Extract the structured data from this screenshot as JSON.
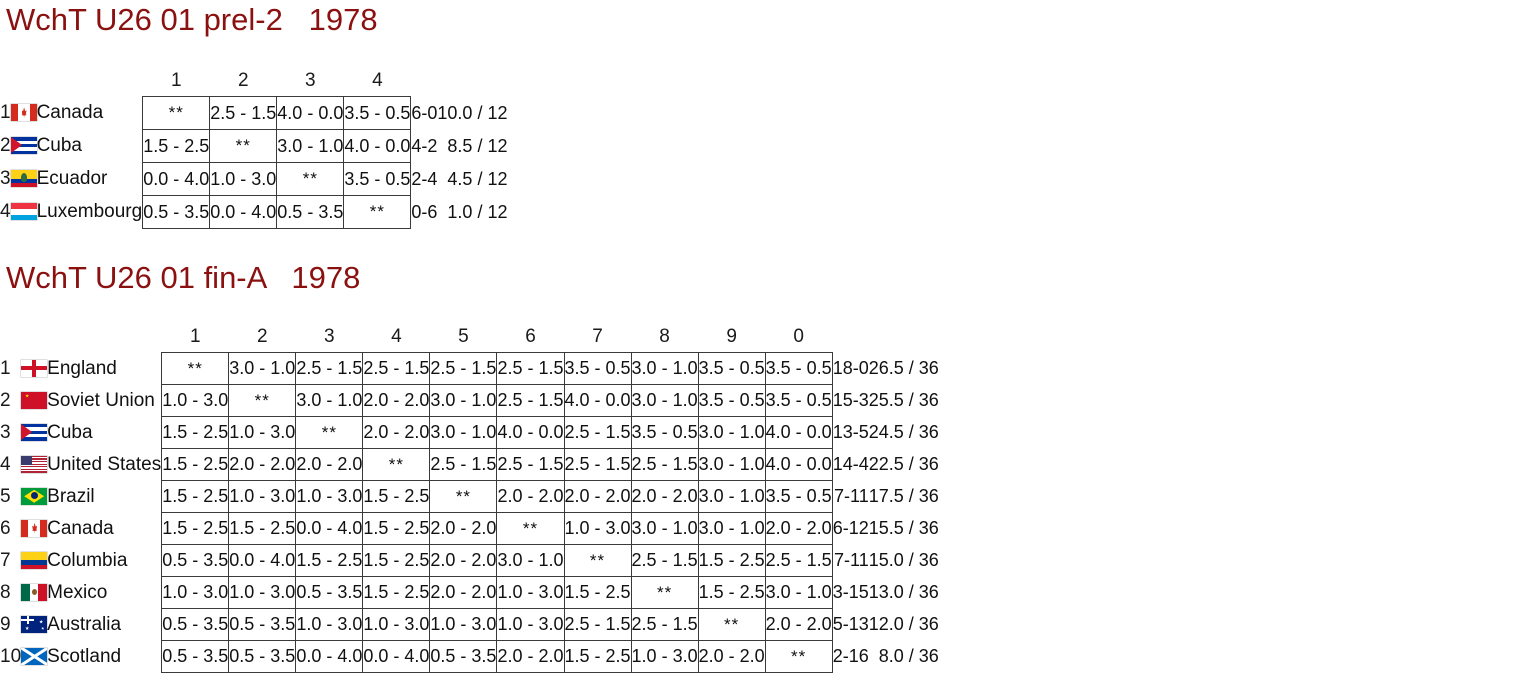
{
  "theme": {
    "title_color": "#8B1010",
    "text_color": "#111111",
    "border_color": "#3a3a3a"
  },
  "sections": [
    {
      "title": "WchT U26 01 prel-2   1978",
      "column_headers": [
        "1",
        "2",
        "3",
        "4"
      ],
      "rows": [
        {
          "rank": "1",
          "flag": "flag-canada",
          "team": "Canada",
          "cells": [
            "**",
            "2.5 - 1.5",
            "4.0 - 0.0",
            "3.5 - 0.5"
          ],
          "match_score": "6-0",
          "points": "10.0 / 12"
        },
        {
          "rank": "2",
          "flag": "flag-cuba",
          "team": "Cuba",
          "cells": [
            "1.5 - 2.5",
            "**",
            "3.0 - 1.0",
            "4.0 - 0.0"
          ],
          "match_score": "4-2",
          "points": "8.5 / 12"
        },
        {
          "rank": "3",
          "flag": "flag-ecuador",
          "team": "Ecuador",
          "cells": [
            "0.0 - 4.0",
            "1.0 - 3.0",
            "**",
            "3.5 - 0.5"
          ],
          "match_score": "2-4",
          "points": "4.5 / 12"
        },
        {
          "rank": "4",
          "flag": "flag-luxembourg",
          "team": "Luxembourg",
          "cells": [
            "0.5 - 3.5",
            "0.0 - 4.0",
            "0.5 - 3.5",
            "**"
          ],
          "match_score": "0-6",
          "points": "1.0 / 12"
        }
      ]
    },
    {
      "title": "WchT U26 01 fin-A   1978",
      "column_headers": [
        "1",
        "2",
        "3",
        "4",
        "5",
        "6",
        "7",
        "8",
        "9",
        "0"
      ],
      "rows": [
        {
          "rank": "1",
          "flag": "flag-england",
          "team": "England",
          "cells": [
            "**",
            "3.0 - 1.0",
            "2.5 - 1.5",
            "2.5 - 1.5",
            "2.5 - 1.5",
            "2.5 - 1.5",
            "3.5 - 0.5",
            "3.0 - 1.0",
            "3.5 - 0.5",
            "3.5 - 0.5"
          ],
          "match_score": "18-0",
          "points": "26.5 / 36"
        },
        {
          "rank": "2",
          "flag": "flag-soviet-union",
          "team": "Soviet Union",
          "cells": [
            "1.0 - 3.0",
            "**",
            "3.0 - 1.0",
            "2.0 - 2.0",
            "3.0 - 1.0",
            "2.5 - 1.5",
            "4.0 - 0.0",
            "3.0 - 1.0",
            "3.5 - 0.5",
            "3.5 - 0.5"
          ],
          "match_score": "15-3",
          "points": "25.5 / 36"
        },
        {
          "rank": "3",
          "flag": "flag-cuba",
          "team": "Cuba",
          "cells": [
            "1.5 - 2.5",
            "1.0 - 3.0",
            "**",
            "2.0 - 2.0",
            "3.0 - 1.0",
            "4.0 - 0.0",
            "2.5 - 1.5",
            "3.5 - 0.5",
            "3.0 - 1.0",
            "4.0 - 0.0"
          ],
          "match_score": "13-5",
          "points": "24.5 / 36"
        },
        {
          "rank": "4",
          "flag": "flag-united-states",
          "team": "United States",
          "cells": [
            "1.5 - 2.5",
            "2.0 - 2.0",
            "2.0 - 2.0",
            "**",
            "2.5 - 1.5",
            "2.5 - 1.5",
            "2.5 - 1.5",
            "2.5 - 1.5",
            "3.0 - 1.0",
            "4.0 - 0.0"
          ],
          "match_score": "14-4",
          "points": "22.5 / 36"
        },
        {
          "rank": "5",
          "flag": "flag-brazil",
          "team": "Brazil",
          "cells": [
            "1.5 - 2.5",
            "1.0 - 3.0",
            "1.0 - 3.0",
            "1.5 - 2.5",
            "**",
            "2.0 - 2.0",
            "2.0 - 2.0",
            "2.0 - 2.0",
            "3.0 - 1.0",
            "3.5 - 0.5"
          ],
          "match_score": "7-11",
          "points": "17.5 / 36"
        },
        {
          "rank": "6",
          "flag": "flag-canada",
          "team": "Canada",
          "cells": [
            "1.5 - 2.5",
            "1.5 - 2.5",
            "0.0 - 4.0",
            "1.5 - 2.5",
            "2.0 - 2.0",
            "**",
            "1.0 - 3.0",
            "3.0 - 1.0",
            "3.0 - 1.0",
            "2.0 - 2.0"
          ],
          "match_score": "6-12",
          "points": "15.5 / 36"
        },
        {
          "rank": "7",
          "flag": "flag-columbia",
          "team": "Columbia",
          "cells": [
            "0.5 - 3.5",
            "0.0 - 4.0",
            "1.5 - 2.5",
            "1.5 - 2.5",
            "2.0 - 2.0",
            "3.0 - 1.0",
            "**",
            "2.5 - 1.5",
            "1.5 - 2.5",
            "2.5 - 1.5"
          ],
          "match_score": "7-11",
          "points": "15.0 / 36"
        },
        {
          "rank": "8",
          "flag": "flag-mexico",
          "team": "Mexico",
          "cells": [
            "1.0 - 3.0",
            "1.0 - 3.0",
            "0.5 - 3.5",
            "1.5 - 2.5",
            "2.0 - 2.0",
            "1.0 - 3.0",
            "1.5 - 2.5",
            "**",
            "1.5 - 2.5",
            "3.0 - 1.0"
          ],
          "match_score": "3-15",
          "points": "13.0 / 36"
        },
        {
          "rank": "9",
          "flag": "flag-australia",
          "team": "Australia",
          "cells": [
            "0.5 - 3.5",
            "0.5 - 3.5",
            "1.0 - 3.0",
            "1.0 - 3.0",
            "1.0 - 3.0",
            "1.0 - 3.0",
            "2.5 - 1.5",
            "2.5 - 1.5",
            "**",
            "2.0 - 2.0"
          ],
          "match_score": "5-13",
          "points": "12.0 / 36"
        },
        {
          "rank": "10",
          "flag": "flag-scotland",
          "team": "Scotland",
          "cells": [
            "0.5 - 3.5",
            "0.5 - 3.5",
            "0.0 - 4.0",
            "0.0 - 4.0",
            "0.5 - 3.5",
            "2.0 - 2.0",
            "1.5 - 2.5",
            "1.0 - 3.0",
            "2.0 - 2.0",
            "**"
          ],
          "match_score": "2-16",
          "points": "8.0 / 36"
        }
      ]
    }
  ]
}
